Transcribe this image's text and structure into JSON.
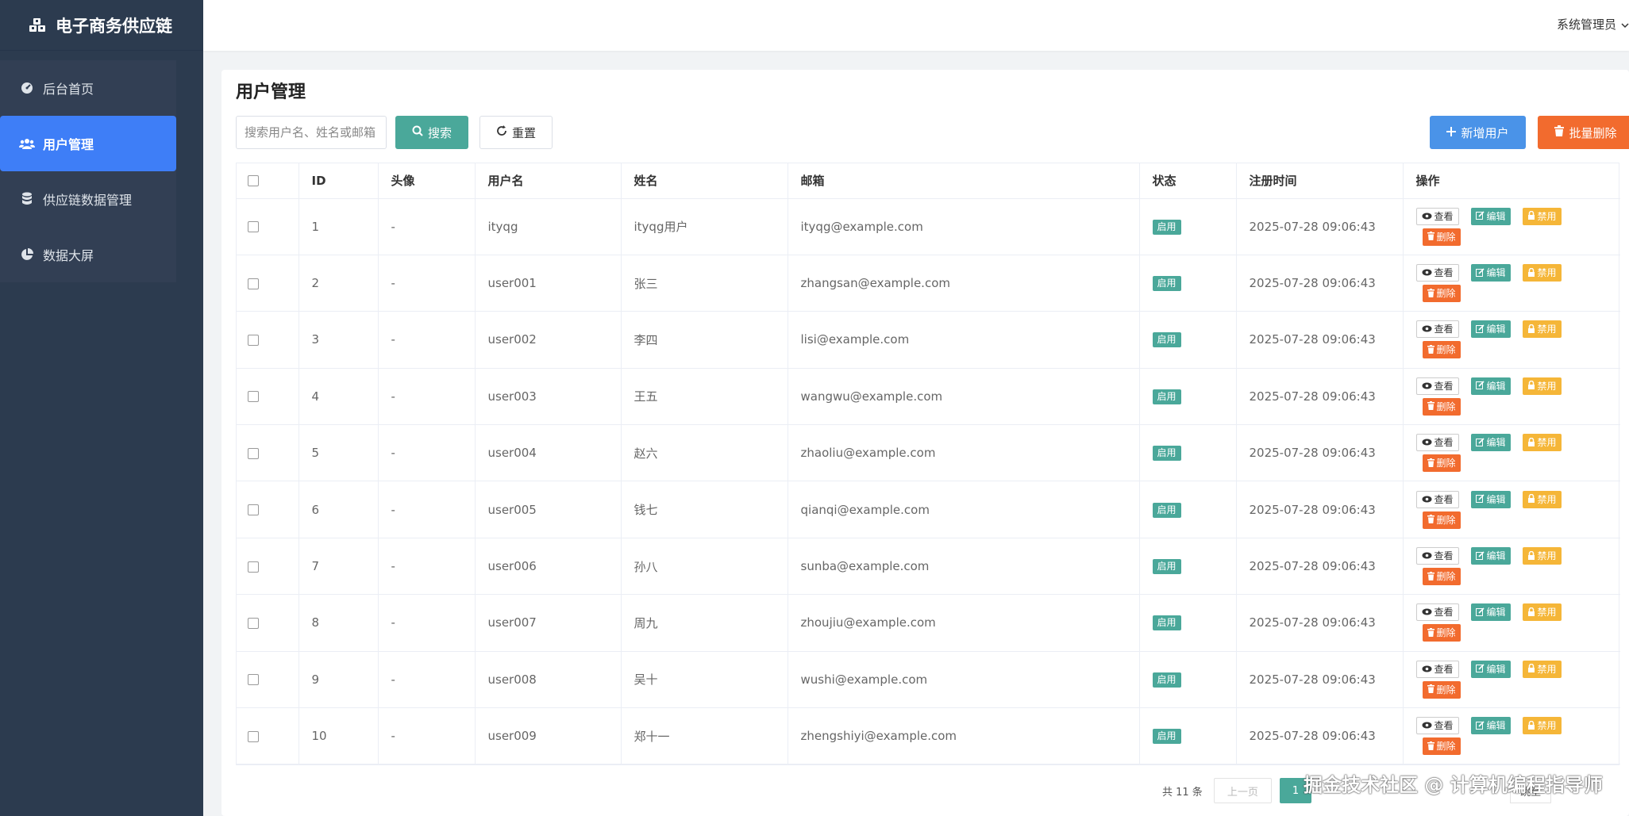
{
  "app": {
    "brand": "电子商务供应链",
    "user": "系统管理员"
  },
  "sidebar": {
    "items": [
      {
        "label": "后台首页",
        "icon": "dashboard-icon"
      },
      {
        "label": "用户管理",
        "icon": "users-icon",
        "active": true
      },
      {
        "label": "供应链数据管理",
        "icon": "database-icon"
      },
      {
        "label": "数据大屏",
        "icon": "pie-chart-icon"
      }
    ]
  },
  "page": {
    "title": "用户管理"
  },
  "toolbar": {
    "search_placeholder": "搜索用户名、姓名或邮箱",
    "search_label": "搜索",
    "reset_label": "重置",
    "add_label": "新增用户",
    "batch_delete_label": "批量删除"
  },
  "table": {
    "columns": [
      "ID",
      "头像",
      "用户名",
      "姓名",
      "邮箱",
      "状态",
      "注册时间",
      "操作"
    ],
    "rows": [
      {
        "id": "1",
        "avatar": "-",
        "username": "ityqg",
        "name": "ityqg用户",
        "email": "ityqg@example.com",
        "status": "启用",
        "registered": "2025-07-28 09:06:43"
      },
      {
        "id": "2",
        "avatar": "-",
        "username": "user001",
        "name": "张三",
        "email": "zhangsan@example.com",
        "status": "启用",
        "registered": "2025-07-28 09:06:43"
      },
      {
        "id": "3",
        "avatar": "-",
        "username": "user002",
        "name": "李四",
        "email": "lisi@example.com",
        "status": "启用",
        "registered": "2025-07-28 09:06:43"
      },
      {
        "id": "4",
        "avatar": "-",
        "username": "user003",
        "name": "王五",
        "email": "wangwu@example.com",
        "status": "启用",
        "registered": "2025-07-28 09:06:43"
      },
      {
        "id": "5",
        "avatar": "-",
        "username": "user004",
        "name": "赵六",
        "email": "zhaoliu@example.com",
        "status": "启用",
        "registered": "2025-07-28 09:06:43"
      },
      {
        "id": "6",
        "avatar": "-",
        "username": "user005",
        "name": "钱七",
        "email": "qianqi@example.com",
        "status": "启用",
        "registered": "2025-07-28 09:06:43"
      },
      {
        "id": "7",
        "avatar": "-",
        "username": "user006",
        "name": "孙八",
        "email": "sunba@example.com",
        "status": "启用",
        "registered": "2025-07-28 09:06:43"
      },
      {
        "id": "8",
        "avatar": "-",
        "username": "user007",
        "name": "周九",
        "email": "zhoujiu@example.com",
        "status": "启用",
        "registered": "2025-07-28 09:06:43"
      },
      {
        "id": "9",
        "avatar": "-",
        "username": "user008",
        "name": "吴十",
        "email": "wushi@example.com",
        "status": "启用",
        "registered": "2025-07-28 09:06:43"
      },
      {
        "id": "10",
        "avatar": "-",
        "username": "user009",
        "name": "郑十一",
        "email": "zhengshiyi@example.com",
        "status": "启用",
        "registered": "2025-07-28 09:06:43"
      }
    ],
    "actions": {
      "view": "查看",
      "edit": "编辑",
      "disable": "禁用",
      "delete": "删除"
    }
  },
  "pagination": {
    "total": "共 11 条",
    "prev": "上一页",
    "current": "1",
    "go": "跳至"
  },
  "watermark": "掘金技术社区 @ 计算机编程指导师",
  "colors": {
    "sidebar": "#2c3b4f",
    "active": "#3e7ef7",
    "teal": "#4aa89a",
    "blue": "#4a93e8",
    "orange": "#f26b2e",
    "yellow": "#f5b638"
  }
}
